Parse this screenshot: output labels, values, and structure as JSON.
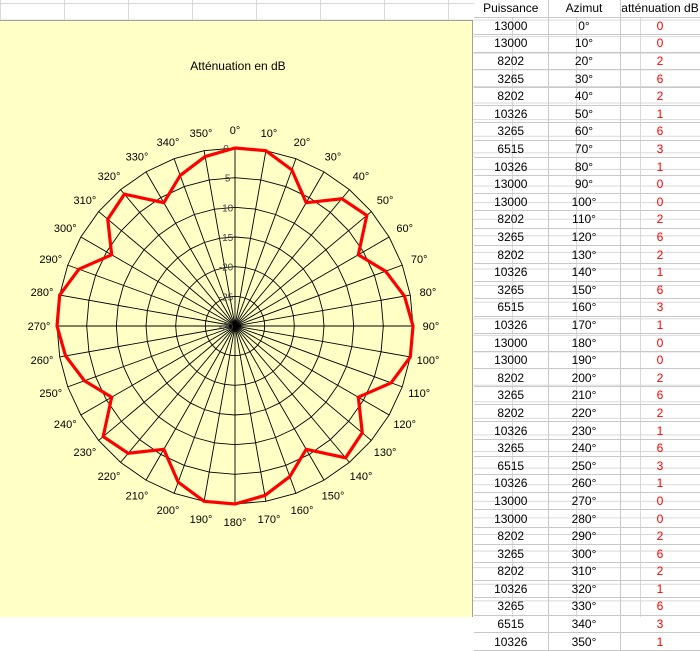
{
  "table": {
    "headers": [
      "Puissance",
      "Azimut",
      "atténuation dB"
    ],
    "rows": [
      [
        "13000",
        "0°",
        "0"
      ],
      [
        "13000",
        "10°",
        "0"
      ],
      [
        "8202",
        "20°",
        "2"
      ],
      [
        "3265",
        "30°",
        "6"
      ],
      [
        "8202",
        "40°",
        "2"
      ],
      [
        "10326",
        "50°",
        "1"
      ],
      [
        "3265",
        "60°",
        "6"
      ],
      [
        "6515",
        "70°",
        "3"
      ],
      [
        "10326",
        "80°",
        "1"
      ],
      [
        "13000",
        "90°",
        "0"
      ],
      [
        "13000",
        "100°",
        "0"
      ],
      [
        "8202",
        "110°",
        "2"
      ],
      [
        "3265",
        "120°",
        "6"
      ],
      [
        "8202",
        "130°",
        "2"
      ],
      [
        "10326",
        "140°",
        "1"
      ],
      [
        "3265",
        "150°",
        "6"
      ],
      [
        "6515",
        "160°",
        "3"
      ],
      [
        "10326",
        "170°",
        "1"
      ],
      [
        "13000",
        "180°",
        "0"
      ],
      [
        "13000",
        "190°",
        "0"
      ],
      [
        "8202",
        "200°",
        "2"
      ],
      [
        "3265",
        "210°",
        "6"
      ],
      [
        "8202",
        "220°",
        "2"
      ],
      [
        "10326",
        "230°",
        "1"
      ],
      [
        "3265",
        "240°",
        "6"
      ],
      [
        "6515",
        "250°",
        "3"
      ],
      [
        "10326",
        "260°",
        "1"
      ],
      [
        "13000",
        "270°",
        "0"
      ],
      [
        "13000",
        "280°",
        "0"
      ],
      [
        "8202",
        "290°",
        "2"
      ],
      [
        "3265",
        "300°",
        "6"
      ],
      [
        "8202",
        "310°",
        "2"
      ],
      [
        "10326",
        "320°",
        "1"
      ],
      [
        "3265",
        "330°",
        "6"
      ],
      [
        "6515",
        "340°",
        "3"
      ],
      [
        "10326",
        "350°",
        "1"
      ]
    ]
  },
  "chart_data": {
    "type": "radar",
    "title": "Atténuation en dB",
    "angles": [
      "0°",
      "10°",
      "20°",
      "30°",
      "40°",
      "50°",
      "60°",
      "70°",
      "80°",
      "90°",
      "100°",
      "110°",
      "120°",
      "130°",
      "140°",
      "150°",
      "160°",
      "170°",
      "180°",
      "190°",
      "200°",
      "210°",
      "220°",
      "230°",
      "240°",
      "250°",
      "260°",
      "270°",
      "280°",
      "290°",
      "300°",
      "310°",
      "320°",
      "330°",
      "340°",
      "350°"
    ],
    "series": [
      {
        "values": [
          0,
          0,
          -2,
          -6,
          -2,
          -1,
          -6,
          -3,
          -1,
          0,
          0,
          -2,
          -6,
          -2,
          -1,
          -6,
          -3,
          -1,
          0,
          0,
          -2,
          -6,
          -2,
          -1,
          -6,
          -3,
          -1,
          0,
          0,
          -2,
          -6,
          -2,
          -1,
          -6,
          -3,
          -1
        ]
      }
    ],
    "radial_ticks": [
      "0",
      "-5",
      "-10",
      "-15",
      "-20",
      "-25",
      "-30"
    ],
    "radial_range": [
      -30,
      0
    ],
    "grid": true,
    "line_color": "#ff0000",
    "background_color": "#ffffc6"
  }
}
